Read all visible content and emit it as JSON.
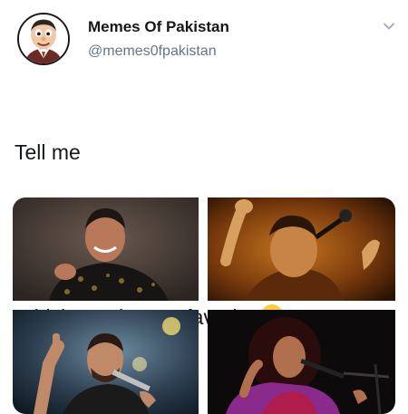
{
  "author": {
    "display_name": "Memes Of Pakistan",
    "handle": "@memes0fpakistan",
    "avatar_icon": "cartoon-avatar"
  },
  "tweet": {
    "lines": [
      "Tell me",
      "Which one is your favorite"
    ],
    "emoji_icon": "hugging-face-emoji"
  },
  "menu_icon": "chevron-down-icon",
  "media": {
    "images": [
      "singer-photo-1",
      "singer-photo-2",
      "singer-photo-3",
      "singer-photo-4"
    ]
  },
  "colors": {
    "text": "#14171a",
    "secondary_text": "#657786",
    "background": "#ffffff"
  }
}
